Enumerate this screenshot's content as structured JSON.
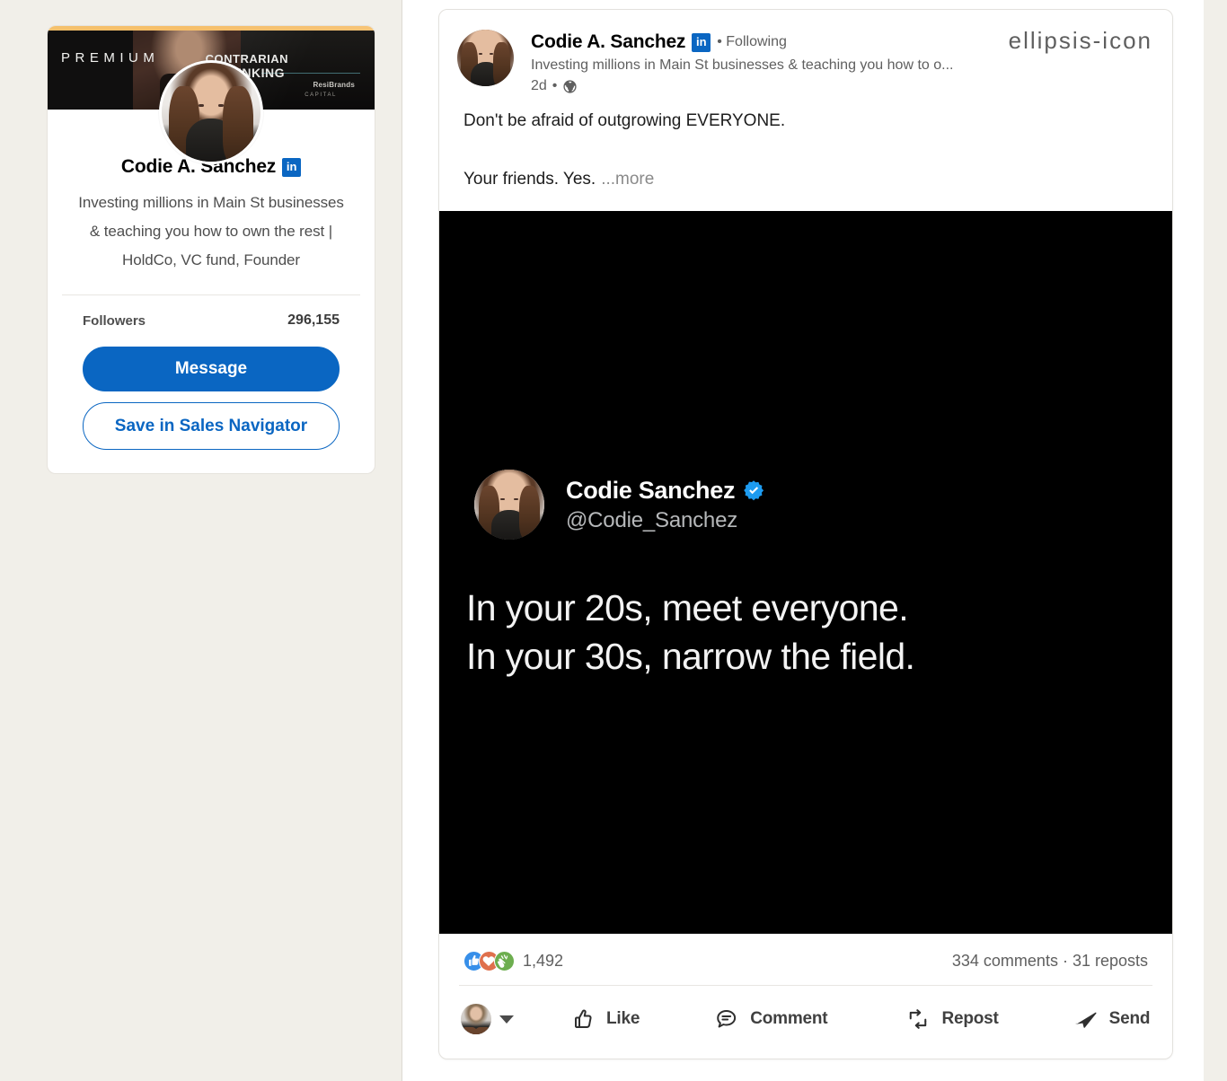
{
  "theme": {
    "linkedin_blue": "#0a66c2",
    "page_bg": "#f1efe9",
    "premium_gold": "#f5c16c",
    "reaction_like": "#378fe9",
    "reaction_love": "#df704d",
    "reaction_celebrate": "#6dae4f"
  },
  "profile_card": {
    "premium_label": "PREMIUM",
    "cover_text_line1": "CONTRARIAN",
    "cover_text_line2": "THINKING",
    "cover_brand_1": "ResiBrands",
    "cover_brand_2": "CAPITAL",
    "name": "Codie A. Sanchez",
    "verified_badge": "in",
    "headline": "Investing millions in Main St businesses & teaching you how to own the rest | HoldCo, VC fund, Founder",
    "followers_label": "Followers",
    "followers_count": "296,155",
    "message_button": "Message",
    "save_button": "Save in Sales Navigator"
  },
  "post": {
    "author_name": "Codie A. Sanchez",
    "author_badge": "in",
    "following_label": "• Following",
    "author_headline": "Investing millions in Main St businesses & teaching you how to o...",
    "time_ago": "2d",
    "time_separator": "•",
    "visibility_icon": "globe-icon",
    "more_icon": "ellipsis-icon",
    "body_line_1": "Don't be afraid of outgrowing EVERYONE.",
    "body_line_2": "Your friends. Yes.",
    "see_more": "...more"
  },
  "media": {
    "tweet_name": "Codie Sanchez",
    "tweet_verified": "verified-icon",
    "tweet_handle": "@Codie_Sanchez",
    "tweet_line_1": "In your 20s, meet everyone.",
    "tweet_line_2": "In your 30s, narrow the field."
  },
  "social": {
    "reaction_icons": [
      "like-icon",
      "love-icon",
      "celebrate-icon"
    ],
    "reaction_count": "1,492",
    "comments_and_reposts": "334 comments · 31 reposts"
  },
  "actions": {
    "avatar_name": "me-avatar",
    "dropdown_icon": "chevron-down-icon",
    "items": [
      {
        "label": "Like",
        "icon": "thumbs-up-icon"
      },
      {
        "label": "Comment",
        "icon": "comment-icon"
      },
      {
        "label": "Repost",
        "icon": "repost-icon"
      },
      {
        "label": "Send",
        "icon": "send-icon"
      }
    ]
  }
}
